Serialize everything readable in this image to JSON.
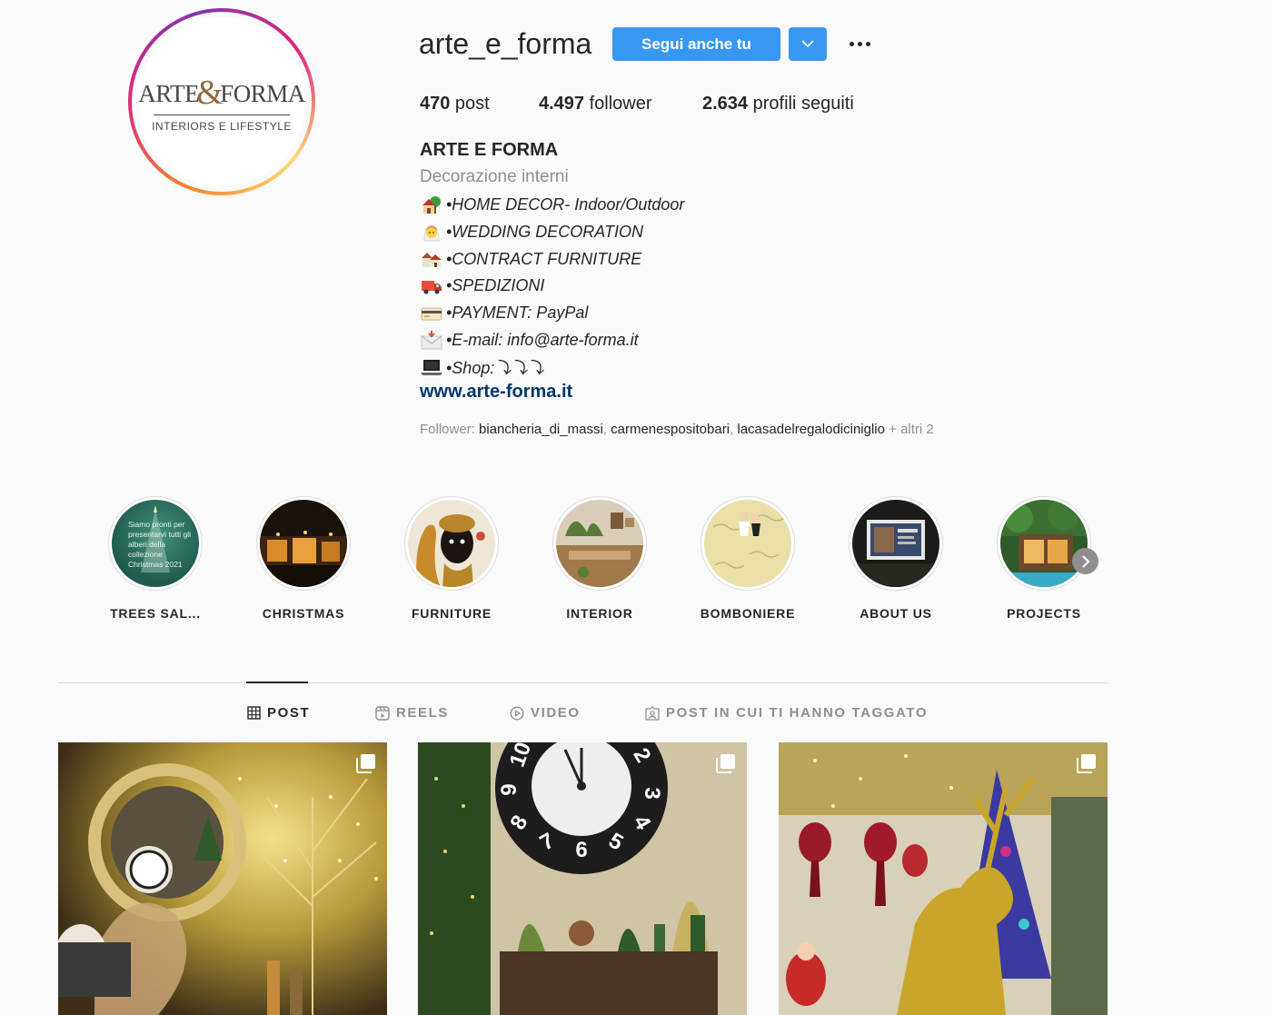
{
  "profile": {
    "avatar": {
      "logo_main_left": "ARTE",
      "logo_amp": "&",
      "logo_main_right": "FORMA",
      "logo_sub": "INTERIORS E LIFESTYLE"
    },
    "username": "arte_e_forma",
    "follow_label": "Segui anche tu",
    "stats": [
      {
        "value": "470",
        "label": " post"
      },
      {
        "value": "4.497",
        "label": " follower"
      },
      {
        "value": "2.634",
        "label": " profili seguiti"
      }
    ],
    "full_name": "ARTE E FORMA",
    "category": "Decorazione interni",
    "bio": [
      {
        "icon": "house-garden-emoji",
        "text": "•HOME DECOR- Indoor/Outdoor"
      },
      {
        "icon": "bride-emoji",
        "text": "•WEDDING DECORATION"
      },
      {
        "icon": "houses-emoji",
        "text": "•CONTRACT FURNITURE"
      },
      {
        "icon": "truck-emoji",
        "text": "•SPEDIZIONI"
      },
      {
        "icon": "credit-card-emoji",
        "text": "•PAYMENT: PayPal"
      },
      {
        "icon": "envelope-emoji",
        "text": "•E-mail: info@arte-forma.it"
      },
      {
        "icon": "laptop-emoji",
        "text": "•Shop:⤵⤵⤵"
      }
    ],
    "website": "www.arte-forma.it",
    "followed_by": {
      "prefix": "Follower: ",
      "accounts": [
        "biancheria_di_massi",
        "carmenespositobari",
        "lacasadelregalodiciniglio"
      ],
      "suffix": " + altri 2"
    }
  },
  "highlights": [
    {
      "label": "TREES SAL...",
      "overlay_text": "Siamo pronti per presentarvi tutti gli alberi della collezione Christmas 2021"
    },
    {
      "label": "CHRISTMAS"
    },
    {
      "label": "FURNITURE"
    },
    {
      "label": "INTERIOR"
    },
    {
      "label": "BOMBONIERE"
    },
    {
      "label": "ABOUT US"
    },
    {
      "label": "PROJECTS"
    }
  ],
  "tabs": [
    {
      "label": "POST",
      "icon": "grid-icon",
      "active": true
    },
    {
      "label": "REELS",
      "icon": "reels-icon",
      "active": false
    },
    {
      "label": "VIDEO",
      "icon": "play-icon",
      "active": false
    },
    {
      "label": "POST IN CUI TI HANNO TAGGATO",
      "icon": "tagged-icon",
      "active": false
    }
  ],
  "clock_numbers": [
    "10",
    "2",
    "3",
    "9",
    "8",
    "7",
    "6",
    "5",
    "4"
  ],
  "colors": {
    "accent": "#3897f0",
    "link": "#00376b",
    "muted": "#8e8e8e",
    "text": "#262626",
    "border": "#dbdbdb"
  }
}
